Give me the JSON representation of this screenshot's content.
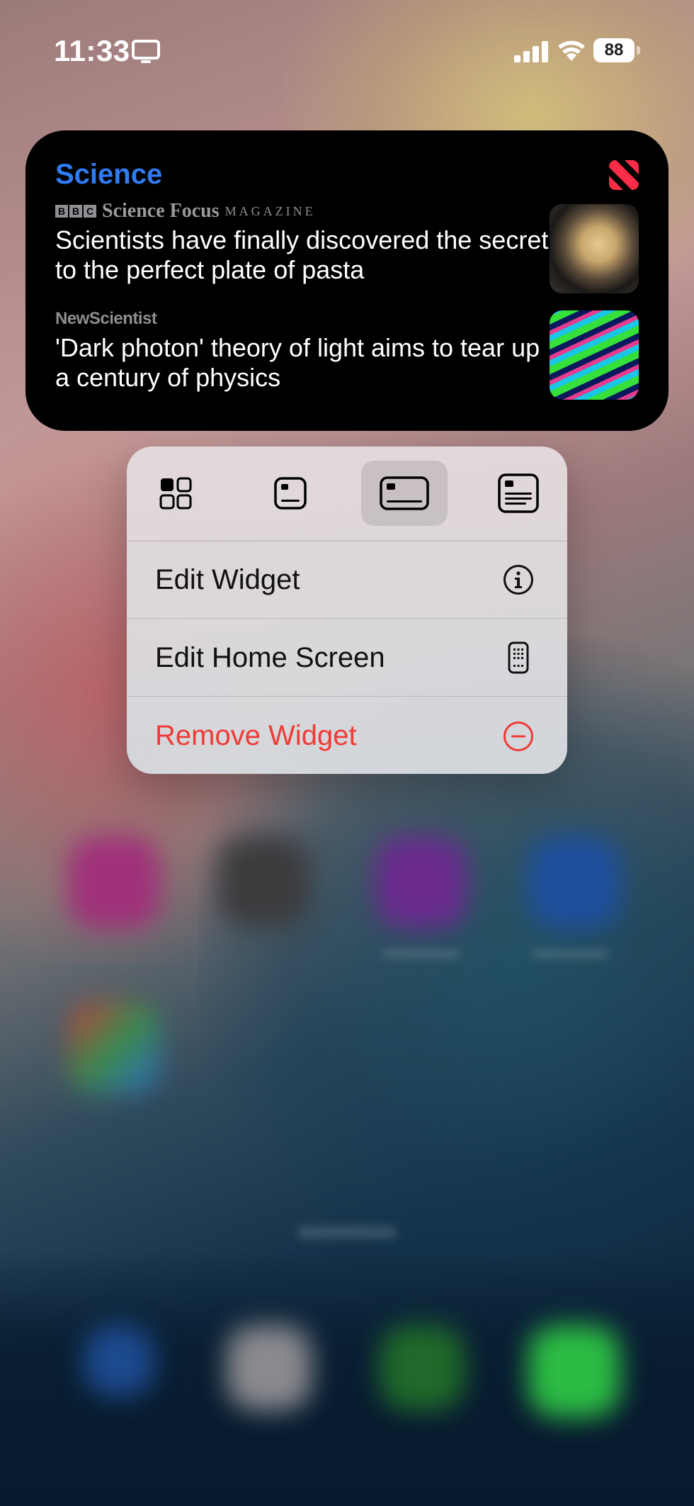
{
  "status_bar": {
    "time": "11:33",
    "battery": "88"
  },
  "widget": {
    "title": "Science",
    "stories": [
      {
        "source_bbc": "BBC",
        "source_name": "Science Focus",
        "source_suffix": "MAGAZINE",
        "headline": "Scientists have finally discovered the secret to the perfect plate of pasta"
      },
      {
        "source_name": "NewScientist",
        "headline": "'Dark photon' theory of light aims to tear up a century of physics"
      }
    ]
  },
  "menu": {
    "sizes": [
      "small",
      "medium",
      "large",
      "extra-large"
    ],
    "selected_size": "large",
    "items": [
      {
        "label": "Edit Widget",
        "icon": "info-icon"
      },
      {
        "label": "Edit Home Screen",
        "icon": "phone-grid-icon"
      },
      {
        "label": "Remove Widget",
        "icon": "minus-circle-icon"
      }
    ]
  },
  "colors": {
    "accent": "#2f7bf5",
    "destructive": "#ee3b36",
    "news_red": "#fa2d48"
  }
}
